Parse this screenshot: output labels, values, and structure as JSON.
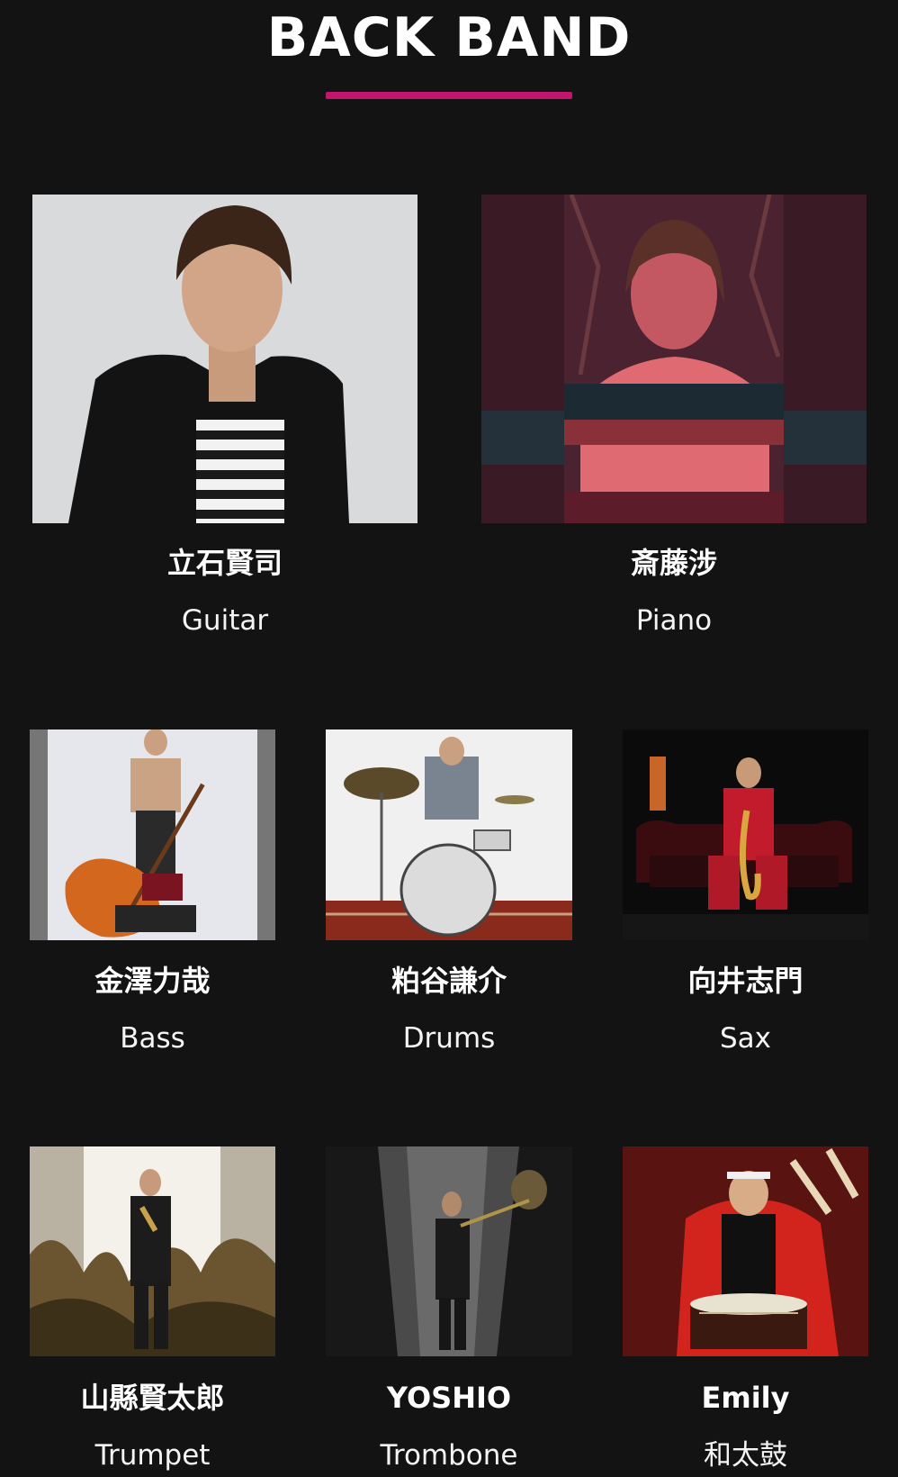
{
  "section": {
    "title": "BACK BAND",
    "accent_color": "#c2166e"
  },
  "members": [
    {
      "name": "立石賢司",
      "role": "Guitar",
      "photo": "portrait-photo"
    },
    {
      "name": "斎藤涉",
      "role": "Piano",
      "photo": "keyboard-player-photo"
    },
    {
      "name": "金澤力哉",
      "role": "Bass",
      "photo": "double-bass-photo"
    },
    {
      "name": "粕谷謙介",
      "role": "Drums",
      "photo": "drummer-photo"
    },
    {
      "name": "向井志門",
      "role": "Sax",
      "photo": "saxophone-photo"
    },
    {
      "name": "山縣賢太郎",
      "role": "Trumpet",
      "photo": "trumpet-photo"
    },
    {
      "name": "YOSHIO",
      "role": "Trombone",
      "photo": "trombone-photo"
    },
    {
      "name": "Emily",
      "role": "和太鼓",
      "photo": "taiko-drum-photo"
    }
  ]
}
